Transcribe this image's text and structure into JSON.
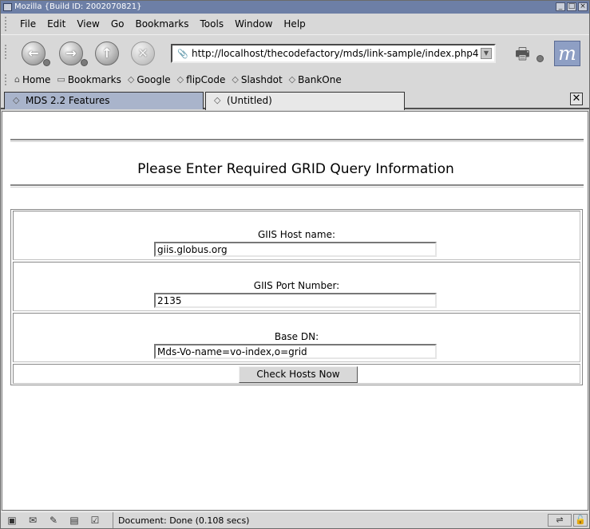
{
  "window": {
    "title": "Mozilla {Build ID: 2002070821}"
  },
  "menubar": {
    "items": [
      {
        "label": "File"
      },
      {
        "label": "Edit"
      },
      {
        "label": "View"
      },
      {
        "label": "Go"
      },
      {
        "label": "Bookmarks"
      },
      {
        "label": "Tools"
      },
      {
        "label": "Window"
      },
      {
        "label": "Help"
      }
    ]
  },
  "navbar": {
    "url": "http://localhost/thecodefactory/mds/link-sample/index.php4",
    "icons": {
      "back": "back-arrow-icon",
      "forward": "forward-arrow-icon",
      "reload": "reload-icon",
      "stop": "stop-icon",
      "print": "print-icon",
      "throbber": "mozilla-logo-icon"
    },
    "throbber_glyph": "m"
  },
  "personal_toolbar": {
    "items": [
      {
        "label": "Home",
        "icon": "home-icon"
      },
      {
        "label": "Bookmarks",
        "icon": "folder-icon"
      },
      {
        "label": "Google",
        "icon": "bookmark-icon"
      },
      {
        "label": "flipCode",
        "icon": "bookmark-icon"
      },
      {
        "label": "Slashdot",
        "icon": "bookmark-icon"
      },
      {
        "label": "BankOne",
        "icon": "bookmark-icon"
      }
    ]
  },
  "tabs": {
    "items": [
      {
        "label": "MDS 2.2 Features",
        "active": false
      },
      {
        "label": "(Untitled)",
        "active": true
      }
    ],
    "close_glyph": "✕"
  },
  "page": {
    "title": "Please Enter Required GRID Query Information",
    "fields": [
      {
        "label": "GIIS Host name:",
        "value": "giis.globus.org"
      },
      {
        "label": "GIIS Port Number:",
        "value": "2135"
      },
      {
        "label": "Base DN:",
        "value": "Mds-Vo-name=vo-index,o=grid"
      }
    ],
    "submit_label": "Check Hosts Now"
  },
  "status": {
    "text": "Document: Done (0.108 secs)"
  },
  "colors": {
    "titlebar": "#6d7fa6",
    "inactive_tab": "#a9b4cb",
    "chrome": "#d8d8d8"
  }
}
